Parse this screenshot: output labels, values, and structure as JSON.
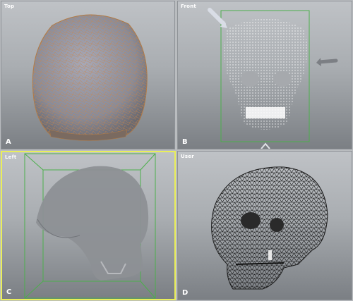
{
  "viewports": {
    "top": {
      "title": "Top",
      "letter": "A"
    },
    "front": {
      "title": "Front",
      "letter": "B"
    },
    "left": {
      "title": "Left",
      "letter": "C",
      "active": true
    },
    "user": {
      "title": "User",
      "letter": "D"
    }
  },
  "colors": {
    "active_border": "#e9ee5a",
    "bounding_box": "#4caf4c",
    "wire_orange": "#c9864a",
    "point_cloud": "#ffffff",
    "mesh_dark": "#1a1a1a"
  },
  "icons": {
    "front_pointer": "arrow-pointer-icon",
    "front_move": "arrow-move-icon",
    "front_pivot": "pivot-marker-icon"
  }
}
